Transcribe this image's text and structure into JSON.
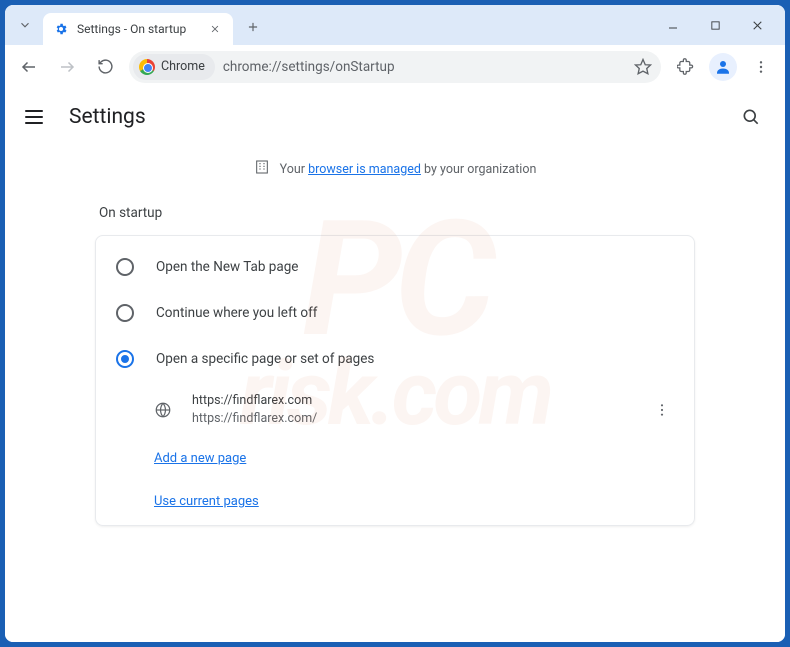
{
  "tab": {
    "title": "Settings - On startup"
  },
  "addressbar": {
    "chip_label": "Chrome",
    "url": "chrome://settings/onStartup"
  },
  "settings": {
    "title": "Settings",
    "managed_prefix": "Your",
    "managed_link": "browser is managed",
    "managed_suffix": "by your organization",
    "section_label": "On startup",
    "options": [
      {
        "label": "Open the New Tab page",
        "selected": false
      },
      {
        "label": "Continue where you left off",
        "selected": false
      },
      {
        "label": "Open a specific page or set of pages",
        "selected": true
      }
    ],
    "page_entry": {
      "title": "https://findflarex.com",
      "url": "https://findflarex.com/"
    },
    "add_page_label": "Add a new page",
    "use_current_label": "Use current pages"
  }
}
